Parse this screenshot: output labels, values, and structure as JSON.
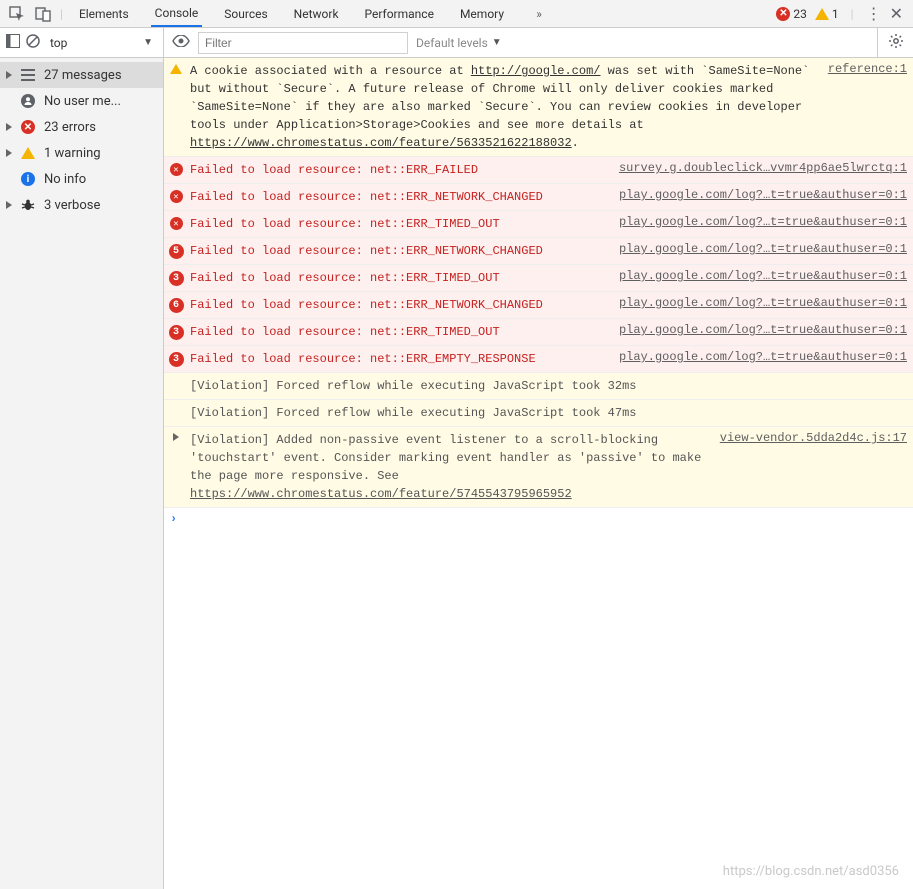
{
  "tabs": {
    "items": [
      "Elements",
      "Console",
      "Sources",
      "Network",
      "Performance",
      "Memory"
    ],
    "active": "Console"
  },
  "status": {
    "error_count": "23",
    "warn_count": "1"
  },
  "toolbar": {
    "context": "top",
    "filter_placeholder": "Filter",
    "levels_label": "Default levels"
  },
  "sidebar": {
    "items": [
      {
        "label": "27 messages",
        "icon": "lines",
        "selected": true,
        "expandable": true
      },
      {
        "label": "No user me...",
        "icon": "user",
        "selected": false,
        "expandable": false
      },
      {
        "label": "23 errors",
        "icon": "error",
        "selected": false,
        "expandable": true
      },
      {
        "label": "1 warning",
        "icon": "warn",
        "selected": false,
        "expandable": true
      },
      {
        "label": "No info",
        "icon": "info",
        "selected": false,
        "expandable": false
      },
      {
        "label": "3 verbose",
        "icon": "bug",
        "selected": false,
        "expandable": true
      }
    ]
  },
  "messages": [
    {
      "type": "warn",
      "pre": "A cookie associated with a resource at ",
      "link1": "http://google.com/",
      "mid": " was set with `SameSite=None` but without `Secure`. A future release of Chrome will only deliver cookies marked `SameSite=None` if they are also marked `Secure`. You can review cookies in developer tools under Application>Storage>Cookies and see more details at ",
      "link2": "https://www.chromestatus.com/feature/5633521622188032",
      "post": ".",
      "source": "reference:1"
    },
    {
      "type": "err",
      "text": "Failed to load resource: net::ERR_FAILED",
      "source": "survey.g.doubleclick…vvmr4pp6ae5lwrctq:1"
    },
    {
      "type": "err",
      "text": "Failed to load resource: net::ERR_NETWORK_CHANGED",
      "source": "play.google.com/log?…t=true&authuser=0:1"
    },
    {
      "type": "err",
      "text": "Failed to load resource: net::ERR_TIMED_OUT",
      "source": "play.google.com/log?…t=true&authuser=0:1"
    },
    {
      "type": "err",
      "count": "5",
      "text": "Failed to load resource: net::ERR_NETWORK_CHANGED",
      "source": "play.google.com/log?…t=true&authuser=0:1"
    },
    {
      "type": "err",
      "count": "3",
      "text": "Failed to load resource: net::ERR_TIMED_OUT",
      "source": "play.google.com/log?…t=true&authuser=0:1"
    },
    {
      "type": "err",
      "count": "6",
      "text": "Failed to load resource: net::ERR_NETWORK_CHANGED",
      "source": "play.google.com/log?…t=true&authuser=0:1"
    },
    {
      "type": "err",
      "count": "3",
      "text": "Failed to load resource: net::ERR_TIMED_OUT",
      "source": "play.google.com/log?…t=true&authuser=0:1"
    },
    {
      "type": "err",
      "count": "3",
      "text": "Failed to load resource: net::ERR_EMPTY_RESPONSE",
      "source": "play.google.com/log?…t=true&authuser=0:1"
    },
    {
      "type": "violation",
      "text": "[Violation] Forced reflow while executing JavaScript took 32ms"
    },
    {
      "type": "violation",
      "text": "[Violation] Forced reflow while executing JavaScript took 47ms"
    },
    {
      "type": "verbose",
      "expandable": true,
      "pre": "[Violation] Added non-passive event listener to a scroll-blocking 'touchstart' event. Consider marking event handler as 'passive' to make the page more responsive. See ",
      "link": "https://www.chromestatus.com/feature/5745543795965952",
      "source": "view-vendor.5dda2d4c.js:17"
    }
  ],
  "watermark": "https://blog.csdn.net/asd0356"
}
